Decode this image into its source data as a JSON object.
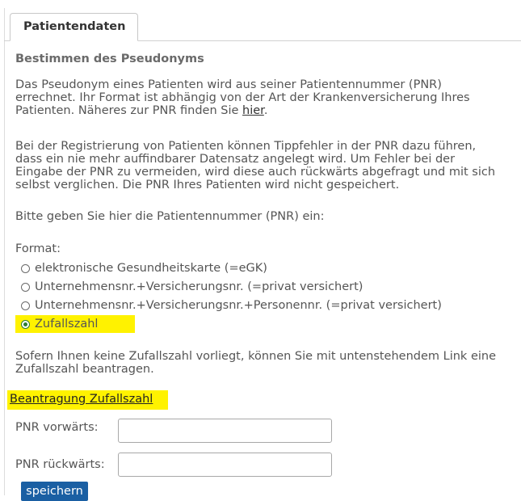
{
  "tab": {
    "label": "Patientendaten"
  },
  "section": {
    "title": "Bestimmen des Pseudonyms"
  },
  "intro": {
    "line1": "Das Pseudonym eines Patienten wird aus seiner Patientennummer (PNR)",
    "line2": "errechnet. Ihr Format ist abhängig von der Art der Krankenversicherung Ihres",
    "line3_prefix": "Patienten. Näheres zur PNR finden Sie ",
    "line3_link": "hier",
    "line3_suffix": "."
  },
  "registration_note": {
    "line1": "Bei der Registrierung von Patienten können Tippfehler in der PNR dazu führen,",
    "line2": "dass ein nie mehr auffindbarer Datensatz angelegt wird. Um Fehler bei der",
    "line3": "Eingabe der PNR zu vermeiden, wird diese auch rückwärts abgefragt und mit sich",
    "line4": "selbst verglichen. Die PNR Ihres Patienten wird nicht gespeichert."
  },
  "instruction": "Bitte geben Sie hier die Patientennummer (PNR) ein:",
  "format": {
    "label": "Format:",
    "options": [
      {
        "label": "elektronische Gesundheitskarte (=eGK)",
        "selected": false
      },
      {
        "label": "Unternehmensnr.+Versicherungsnr. (=privat versichert)",
        "selected": false
      },
      {
        "label": "Unternehmensnr.+Versicherungsnr.+Personennr. (=privat versichert)",
        "selected": false
      },
      {
        "label": "Zufallszahl",
        "selected": true
      }
    ]
  },
  "random_note": {
    "line1": "Sofern Ihnen keine Zufallszahl vorliegt, können Sie mit untenstehendem Link eine",
    "line2": "Zufallszahl beantragen."
  },
  "request_link": "Beantragung Zufallszahl",
  "fields": {
    "forward_label": "PNR vorwärts:",
    "forward_value": "",
    "backward_label": "PNR rückwärts:",
    "backward_value": ""
  },
  "save_button": "speichern",
  "colors": {
    "highlight": "#fff200",
    "button": "#1a5fa3",
    "radio_selected": "#2e7d32"
  }
}
